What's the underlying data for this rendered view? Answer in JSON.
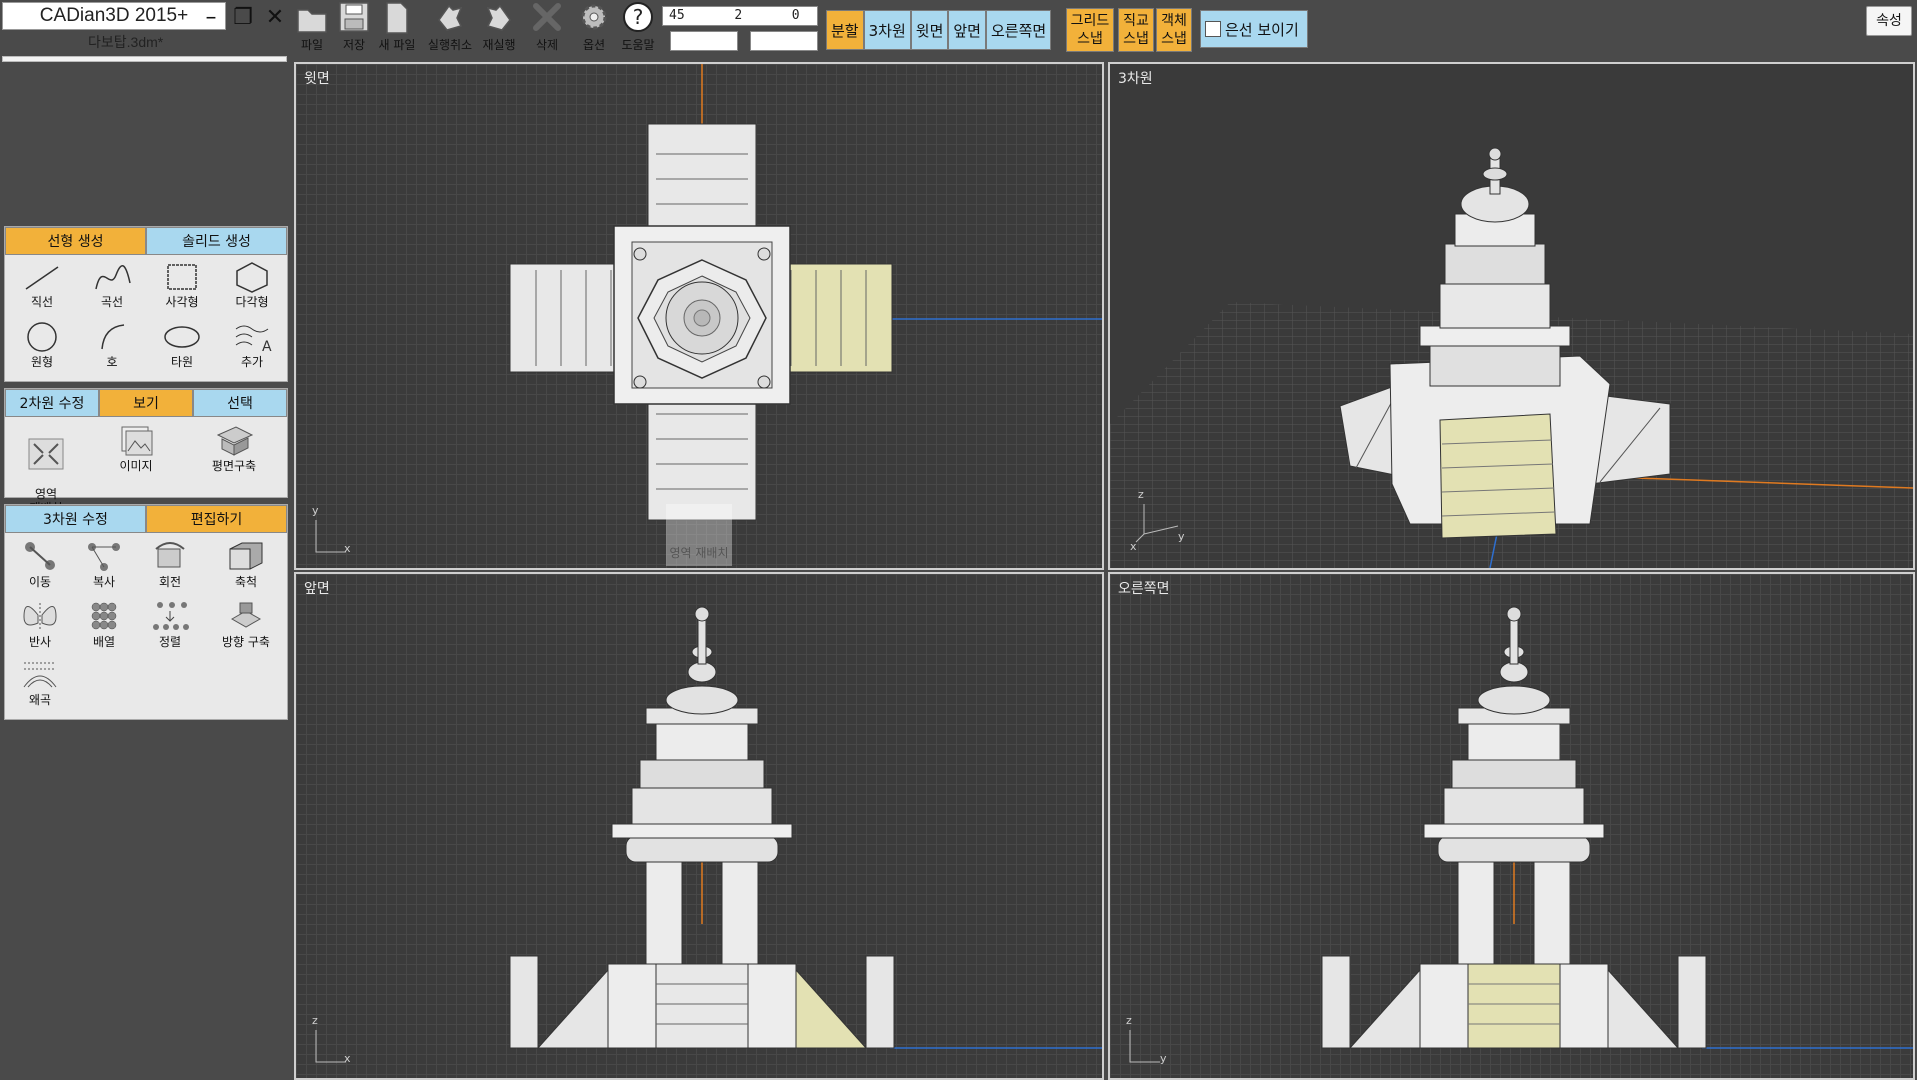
{
  "app": {
    "title": "CADian3D 2015+",
    "file_name": "다보탑.3dm*"
  },
  "toolbar": {
    "tools": [
      {
        "id": "open",
        "label": "파일",
        "icon": "folder-icon"
      },
      {
        "id": "save",
        "label": "저장",
        "icon": "save-icon"
      },
      {
        "id": "new",
        "label": "새 파일",
        "icon": "new-file-icon"
      },
      {
        "id": "undo",
        "label": "실행취소",
        "icon": "undo-icon"
      },
      {
        "id": "redo",
        "label": "재실행",
        "icon": "redo-icon"
      },
      {
        "id": "delete",
        "label": "삭제",
        "icon": "delete-icon"
      },
      {
        "id": "options",
        "label": "옵션",
        "icon": "gear-icon"
      },
      {
        "id": "help",
        "label": "도움말",
        "icon": "help-icon"
      }
    ],
    "coords": {
      "x": "45",
      "y": "2",
      "z": "0",
      "r": "",
      "a": ""
    }
  },
  "view_buttons": [
    {
      "label": "분할",
      "active": true
    },
    {
      "label": "3차원",
      "active": false
    },
    {
      "label": "윗면",
      "active": false
    },
    {
      "label": "앞면",
      "active": false
    },
    {
      "label": "오른쪽면",
      "active": false
    }
  ],
  "snaps": [
    {
      "line1": "그리드",
      "line2": "스냅"
    },
    {
      "line1": "직교",
      "line2": "스냅"
    },
    {
      "line1": "객체",
      "line2": "스냅"
    }
  ],
  "hidden_lines": {
    "label": "은선 보이기",
    "checked": false
  },
  "properties_label": "속성",
  "panels": {
    "create": {
      "tabs": [
        "선형 생성",
        "솔리드 생성"
      ],
      "active_tab": 0,
      "tools": [
        "직선",
        "곡선",
        "사각형",
        "다각형",
        "원형",
        "호",
        "타원",
        "추가"
      ]
    },
    "modify2d": {
      "tabs": [
        "2차원 수정",
        "보기",
        "선택"
      ],
      "active_tab": 1,
      "tools": [
        "영역\n재배치",
        "이미지",
        "평면구축"
      ]
    },
    "modify3d": {
      "tabs": [
        "3차원 수정",
        "편집하기"
      ],
      "active_tab": 1,
      "tools": [
        "이동",
        "복사",
        "회전",
        "축척",
        "반사",
        "배열",
        "정렬",
        "방향 구축",
        "왜곡"
      ]
    }
  },
  "viewports": {
    "top": {
      "title": "윗면",
      "axis1": "y",
      "axis2": "x"
    },
    "perspective": {
      "title": "3차원",
      "axis1": "z",
      "axis2": "y",
      "axis3": "x"
    },
    "front": {
      "title": "앞면",
      "axis1": "z",
      "axis2": "x"
    },
    "right": {
      "title": "오른쪽면",
      "axis1": "z",
      "axis2": "y"
    }
  },
  "watermark_label": "영역 재배치",
  "colors": {
    "accent": "#f2b13a",
    "idle": "#a9d8ef",
    "highlight": "#e3e1b3",
    "axis_x": "#e07a20",
    "axis_y": "#2e6fd0"
  }
}
